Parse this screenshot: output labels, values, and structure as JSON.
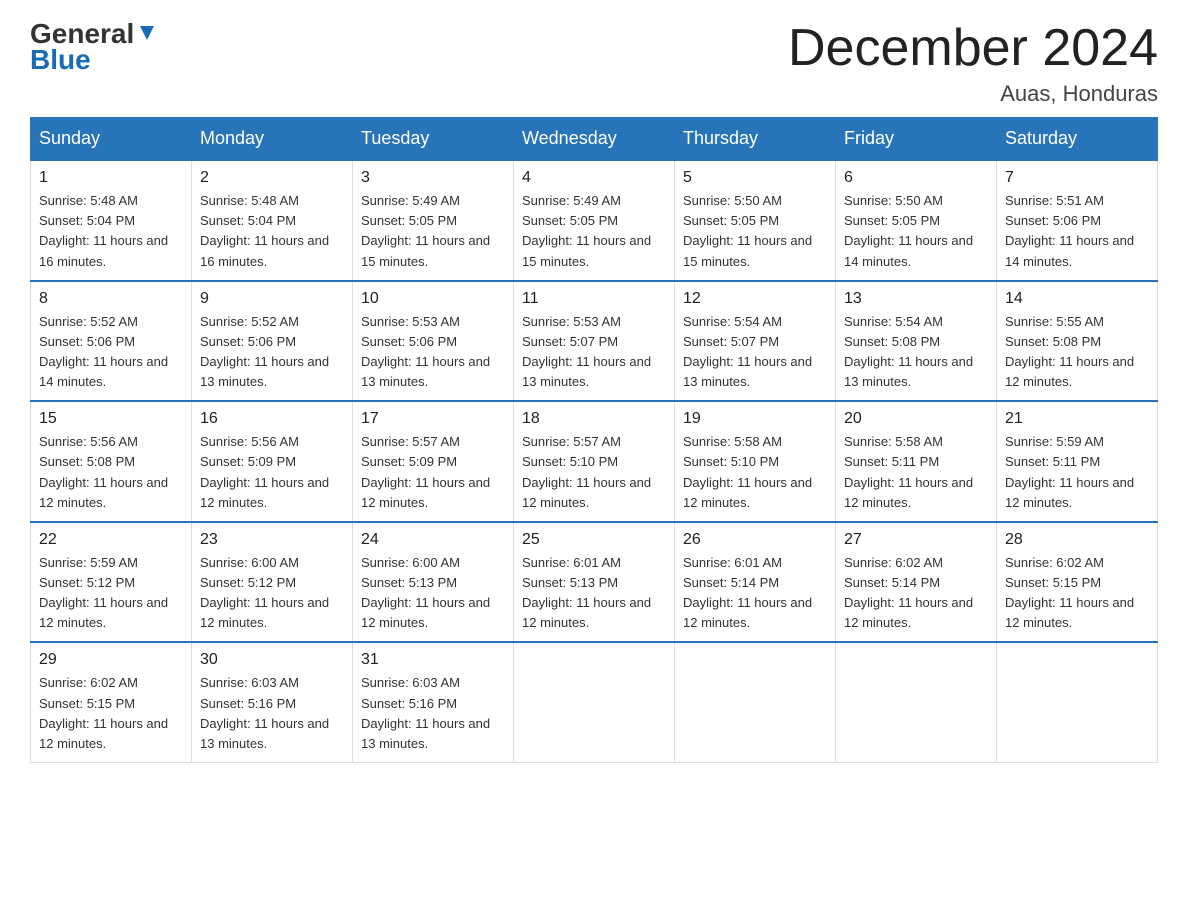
{
  "logo": {
    "general": "General",
    "blue": "Blue"
  },
  "header": {
    "month": "December 2024",
    "location": "Auas, Honduras"
  },
  "days_header": [
    "Sunday",
    "Monday",
    "Tuesday",
    "Wednesday",
    "Thursday",
    "Friday",
    "Saturday"
  ],
  "weeks": [
    [
      {
        "day": "1",
        "sunrise": "5:48 AM",
        "sunset": "5:04 PM",
        "daylight": "11 hours and 16 minutes."
      },
      {
        "day": "2",
        "sunrise": "5:48 AM",
        "sunset": "5:04 PM",
        "daylight": "11 hours and 16 minutes."
      },
      {
        "day": "3",
        "sunrise": "5:49 AM",
        "sunset": "5:05 PM",
        "daylight": "11 hours and 15 minutes."
      },
      {
        "day": "4",
        "sunrise": "5:49 AM",
        "sunset": "5:05 PM",
        "daylight": "11 hours and 15 minutes."
      },
      {
        "day": "5",
        "sunrise": "5:50 AM",
        "sunset": "5:05 PM",
        "daylight": "11 hours and 15 minutes."
      },
      {
        "day": "6",
        "sunrise": "5:50 AM",
        "sunset": "5:05 PM",
        "daylight": "11 hours and 14 minutes."
      },
      {
        "day": "7",
        "sunrise": "5:51 AM",
        "sunset": "5:06 PM",
        "daylight": "11 hours and 14 minutes."
      }
    ],
    [
      {
        "day": "8",
        "sunrise": "5:52 AM",
        "sunset": "5:06 PM",
        "daylight": "11 hours and 14 minutes."
      },
      {
        "day": "9",
        "sunrise": "5:52 AM",
        "sunset": "5:06 PM",
        "daylight": "11 hours and 13 minutes."
      },
      {
        "day": "10",
        "sunrise": "5:53 AM",
        "sunset": "5:06 PM",
        "daylight": "11 hours and 13 minutes."
      },
      {
        "day": "11",
        "sunrise": "5:53 AM",
        "sunset": "5:07 PM",
        "daylight": "11 hours and 13 minutes."
      },
      {
        "day": "12",
        "sunrise": "5:54 AM",
        "sunset": "5:07 PM",
        "daylight": "11 hours and 13 minutes."
      },
      {
        "day": "13",
        "sunrise": "5:54 AM",
        "sunset": "5:08 PM",
        "daylight": "11 hours and 13 minutes."
      },
      {
        "day": "14",
        "sunrise": "5:55 AM",
        "sunset": "5:08 PM",
        "daylight": "11 hours and 12 minutes."
      }
    ],
    [
      {
        "day": "15",
        "sunrise": "5:56 AM",
        "sunset": "5:08 PM",
        "daylight": "11 hours and 12 minutes."
      },
      {
        "day": "16",
        "sunrise": "5:56 AM",
        "sunset": "5:09 PM",
        "daylight": "11 hours and 12 minutes."
      },
      {
        "day": "17",
        "sunrise": "5:57 AM",
        "sunset": "5:09 PM",
        "daylight": "11 hours and 12 minutes."
      },
      {
        "day": "18",
        "sunrise": "5:57 AM",
        "sunset": "5:10 PM",
        "daylight": "11 hours and 12 minutes."
      },
      {
        "day": "19",
        "sunrise": "5:58 AM",
        "sunset": "5:10 PM",
        "daylight": "11 hours and 12 minutes."
      },
      {
        "day": "20",
        "sunrise": "5:58 AM",
        "sunset": "5:11 PM",
        "daylight": "11 hours and 12 minutes."
      },
      {
        "day": "21",
        "sunrise": "5:59 AM",
        "sunset": "5:11 PM",
        "daylight": "11 hours and 12 minutes."
      }
    ],
    [
      {
        "day": "22",
        "sunrise": "5:59 AM",
        "sunset": "5:12 PM",
        "daylight": "11 hours and 12 minutes."
      },
      {
        "day": "23",
        "sunrise": "6:00 AM",
        "sunset": "5:12 PM",
        "daylight": "11 hours and 12 minutes."
      },
      {
        "day": "24",
        "sunrise": "6:00 AM",
        "sunset": "5:13 PM",
        "daylight": "11 hours and 12 minutes."
      },
      {
        "day": "25",
        "sunrise": "6:01 AM",
        "sunset": "5:13 PM",
        "daylight": "11 hours and 12 minutes."
      },
      {
        "day": "26",
        "sunrise": "6:01 AM",
        "sunset": "5:14 PM",
        "daylight": "11 hours and 12 minutes."
      },
      {
        "day": "27",
        "sunrise": "6:02 AM",
        "sunset": "5:14 PM",
        "daylight": "11 hours and 12 minutes."
      },
      {
        "day": "28",
        "sunrise": "6:02 AM",
        "sunset": "5:15 PM",
        "daylight": "11 hours and 12 minutes."
      }
    ],
    [
      {
        "day": "29",
        "sunrise": "6:02 AM",
        "sunset": "5:15 PM",
        "daylight": "11 hours and 12 minutes."
      },
      {
        "day": "30",
        "sunrise": "6:03 AM",
        "sunset": "5:16 PM",
        "daylight": "11 hours and 13 minutes."
      },
      {
        "day": "31",
        "sunrise": "6:03 AM",
        "sunset": "5:16 PM",
        "daylight": "11 hours and 13 minutes."
      },
      null,
      null,
      null,
      null
    ]
  ]
}
